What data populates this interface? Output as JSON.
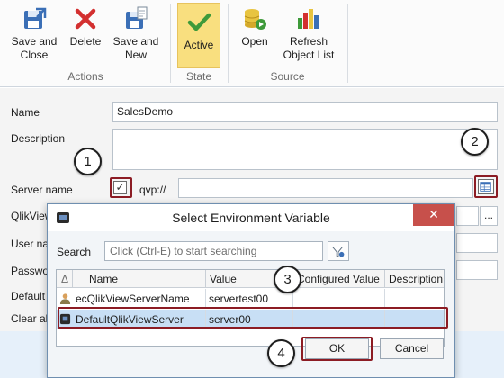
{
  "ribbon": {
    "save_close": "Save and\nClose",
    "delete": "Delete",
    "save_new": "Save and\nNew",
    "active": "Active",
    "open": "Open",
    "refresh": "Refresh\nObject List",
    "groups": {
      "actions": "Actions",
      "state": "State",
      "source": "Source"
    }
  },
  "form": {
    "name_label": "Name",
    "name_value": "SalesDemo",
    "description_label": "Description",
    "description_value": "",
    "server_label": "Server name",
    "server_checked": true,
    "server_prefix": "qvp://",
    "server_value": "",
    "qlikview_label": "QlikView",
    "user_label": "User nan",
    "password_label": "Passwo",
    "default_label": "Default",
    "clear_label": "Clear all",
    "more_button": "..."
  },
  "callouts": [
    "1",
    "2",
    "3",
    "4"
  ],
  "dialog": {
    "title": "Select Environment Variable",
    "close": "✕",
    "search_label": "Search",
    "search_placeholder": "Click (Ctrl-E) to start searching",
    "columns": [
      "Δ",
      "Name",
      "Value",
      "Configured Value",
      "Description"
    ],
    "rows": [
      {
        "name": "ecQlikViewServerName",
        "value": "servertest00",
        "configured": "",
        "description": ""
      },
      {
        "name": "DefaultQlikViewServer",
        "value": "server00",
        "configured": "",
        "description": ""
      }
    ],
    "ok": "OK",
    "cancel": "Cancel"
  },
  "colors": {
    "accent_red": "#8c1c24",
    "selection": "#c8dff5",
    "active": "#f9df7f"
  },
  "icons": [
    "save-close-icon",
    "delete-icon",
    "save-new-icon",
    "checkmark-icon",
    "open-db-icon",
    "refresh-chart-icon",
    "browse-icon",
    "filter-icon",
    "user-icon",
    "server-icon"
  ]
}
